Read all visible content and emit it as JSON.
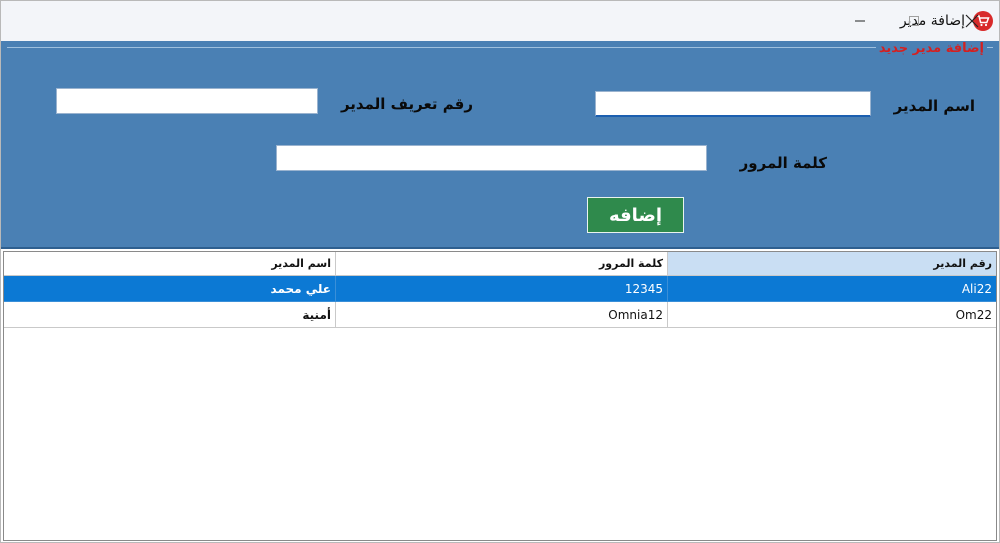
{
  "window": {
    "title": "إضافة مدير",
    "icons": {
      "app": "cart-icon",
      "minimize": "minimize-icon",
      "maximize": "maximize-icon",
      "close": "close-icon"
    }
  },
  "form": {
    "group_title": "إضافة مدير جديد",
    "name_label": "اسم المدير",
    "name_value": "",
    "id_label": "رقم تعريف المدير",
    "id_value": "",
    "password_label": "كلمة المرور",
    "password_value": "",
    "add_button": "إضافه"
  },
  "grid": {
    "columns": [
      "رقم المدير",
      "كلمة المرور",
      "اسم المدير"
    ],
    "rows": [
      {
        "id": "Ali22",
        "password": "12345",
        "name": "علي محمد",
        "selected": true
      },
      {
        "id": "Om22",
        "password": "Omnia12",
        "name": "أمنية",
        "selected": false
      }
    ]
  },
  "colors": {
    "panel": "#4a80b4",
    "group_title": "#d42020",
    "add_button": "#2f8a4c",
    "selection": "#0c79d4",
    "header_highlight": "#c9def3"
  }
}
